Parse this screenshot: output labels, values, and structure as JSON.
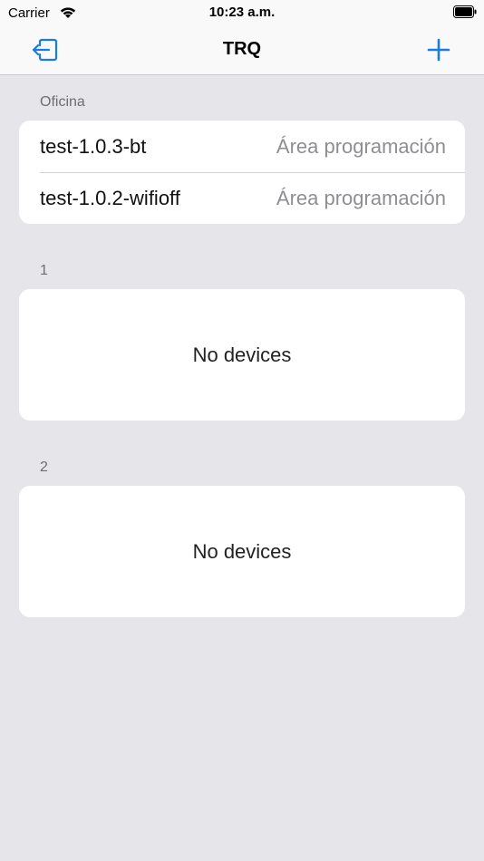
{
  "status_bar": {
    "carrier": "Carrier",
    "time": "10:23 a.m."
  },
  "nav": {
    "title": "TRQ",
    "left_icon": "logout-icon",
    "right_icon": "plus-icon",
    "accent_color": "#1a7be0"
  },
  "sections": [
    {
      "header": "Oficina",
      "rows": [
        {
          "name": "test-1.0.3-bt",
          "detail": "Área programación"
        },
        {
          "name": "test-1.0.2-wifioff",
          "detail": "Área programación"
        }
      ]
    },
    {
      "header": "1",
      "empty_text": "No devices"
    },
    {
      "header": "2",
      "empty_text": "No devices"
    }
  ]
}
